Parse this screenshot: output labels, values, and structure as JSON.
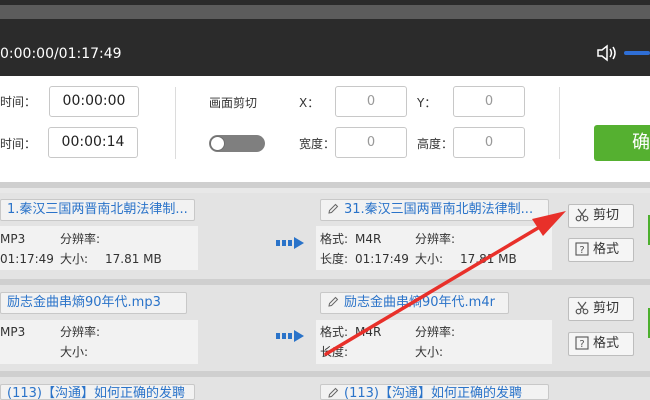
{
  "player": {
    "time": "0:00:00/01:17:49"
  },
  "settings": {
    "start_label": "时间：",
    "start_value": "00:00:00",
    "end_label": "时间：",
    "end_value": "00:00:14",
    "crop_label": "画面剪切",
    "x_label": "X：",
    "x_value": "0",
    "y_label": "Y：",
    "y_value": "0",
    "width_label": "宽度：",
    "width_value": "0",
    "height_label": "高度：",
    "height_value": "0",
    "confirm_label": "确"
  },
  "labels": {
    "format": "格式:",
    "resolution": "分辨率:",
    "duration": "长度:",
    "size": "大小:",
    "cut": "剪切",
    "format_btn": "格式"
  },
  "rows": [
    {
      "src_name": "1.秦汉三国两晋南北朝法律制...",
      "src_format": "MP3",
      "src_duration": "01:17:49",
      "src_size": "17.81 MB",
      "dst_name": "31.秦汉三国两晋南北朝法律制...",
      "dst_format": "M4R",
      "dst_duration": "01:17:49",
      "dst_size": "17.81 MB"
    },
    {
      "src_name": "励志金曲串熵90年代.mp3",
      "src_format": "MP3",
      "dst_name": "励志金曲串熵90年代.m4r",
      "dst_format": "M4R"
    },
    {
      "src_name": "(113)【沟通】如何正确的发聘",
      "dst_name": "(113)【沟通】如何正确的发聘"
    }
  ],
  "colors": {
    "accent_blue": "#2a73c9",
    "confirm_green": "#55b030",
    "annotation_red": "#e8302a"
  }
}
